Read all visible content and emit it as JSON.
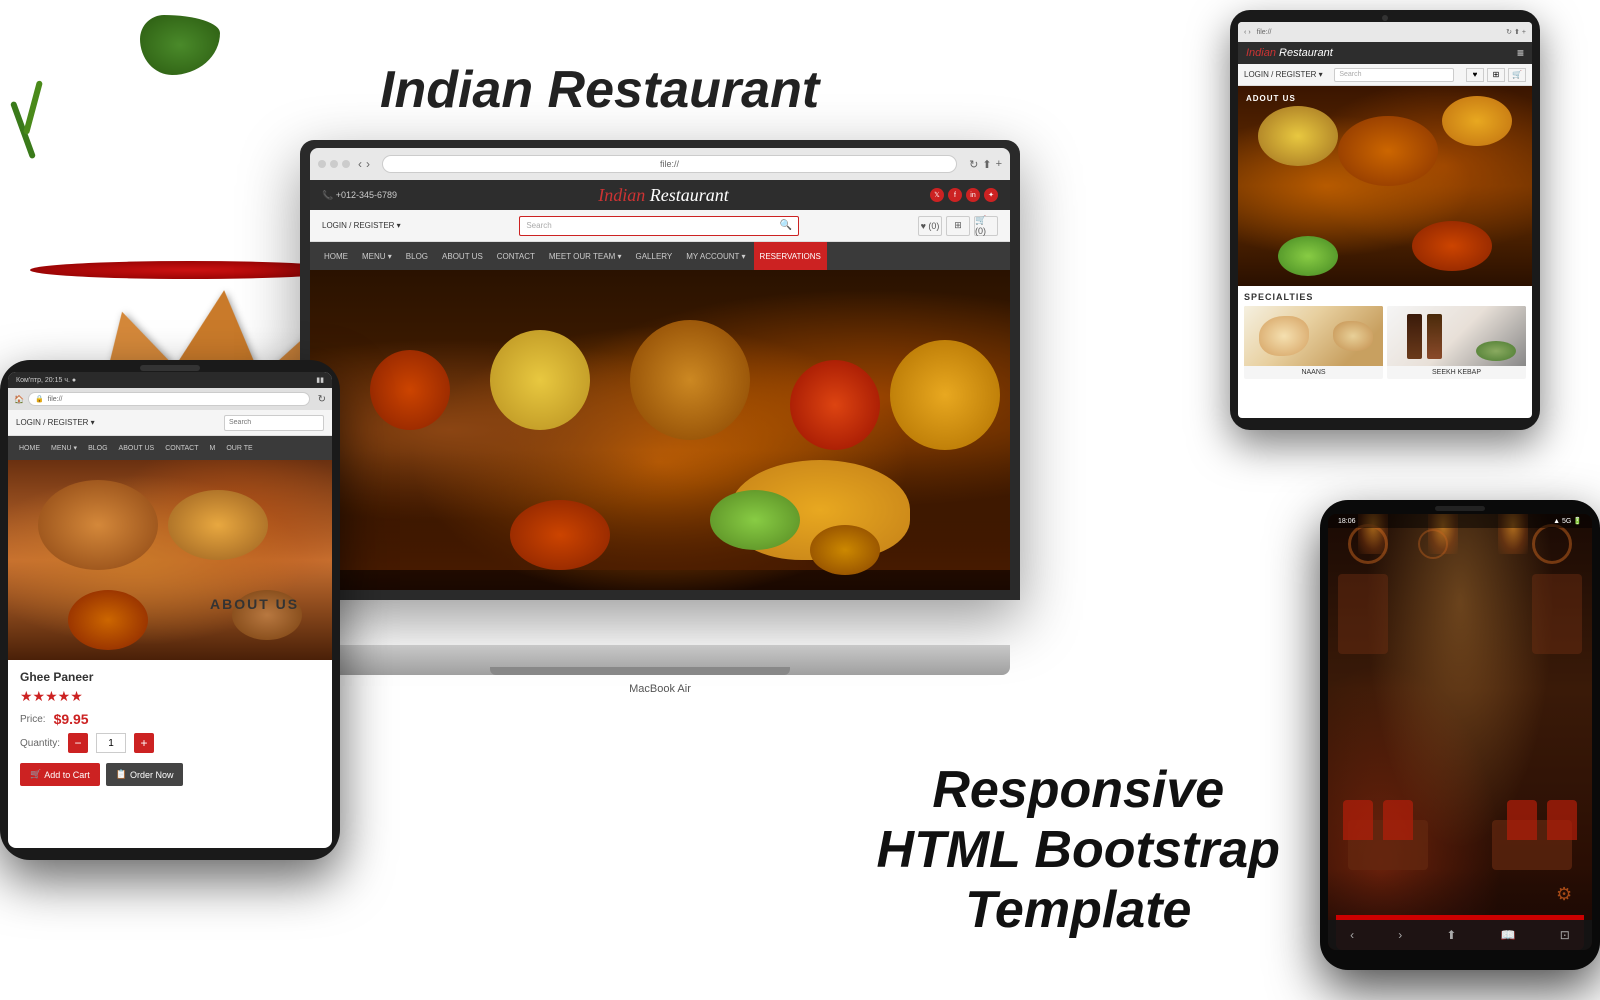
{
  "page": {
    "title": "Indian Restaurant - Responsive HTML Bootstrap Template",
    "main_title": "Indian Restaurant",
    "subtitle_line1": "Responsive",
    "subtitle_line2": "HTML Bootstrap",
    "subtitle_line3": "Template"
  },
  "laptop": {
    "label": "MacBook Air",
    "browser": {
      "url": "file://"
    },
    "website": {
      "phone": "+012-345-6789",
      "logo": "Indian Restaurant",
      "search_placeholder": "Search",
      "login_text": "LOGIN / REGISTER ▾",
      "nav_items": [
        "HOME",
        "MENU ▾",
        "BLOG",
        "ABOUT US",
        "CONTACT",
        "MEET OUR TEAM ▾",
        "GALLERY",
        "MY ACCOUNT ▾"
      ],
      "reservations_btn": "RESERVATIONS"
    }
  },
  "tablet": {
    "about_us": "ADOUT US",
    "logo": "Indian Restaurant",
    "search_placeholder": "Search",
    "specialties_title": "SPECIALTIES",
    "food_items": [
      {
        "name": "NAANS",
        "img_style": "naan"
      },
      {
        "name": "SEEKH KEBAP",
        "img_style": "kebab"
      }
    ],
    "menu_icon": "≡"
  },
  "phone_left": {
    "status_bar": "Ком'птр, 20:15 ч. ●",
    "url": "file://",
    "login_text": "LOGIN / REGISTER ▾",
    "search_placeholder": "Search",
    "nav_items": [
      "HOME",
      "MENU ▾",
      "BLOG",
      "ABOUT US",
      "CONTACT",
      "M",
      "OUR TE"
    ],
    "product": {
      "name": "Ghee Paneer",
      "stars": "★★★★★",
      "price_label": "Price:",
      "price": "$9.95",
      "qty_label": "Quantity:",
      "qty_value": "1",
      "add_to_cart": "Add to Cart",
      "order_now": "Order Now"
    }
  },
  "phone_right": {
    "time": "18:06",
    "signal": "5G",
    "interior_description": "Restaurant interior with warm lighting and red furniture"
  },
  "about_us_label": "ABOUT US",
  "colors": {
    "red": "#cc2222",
    "dark": "#2d2d2d",
    "nav_bg": "#3a3a3a"
  }
}
